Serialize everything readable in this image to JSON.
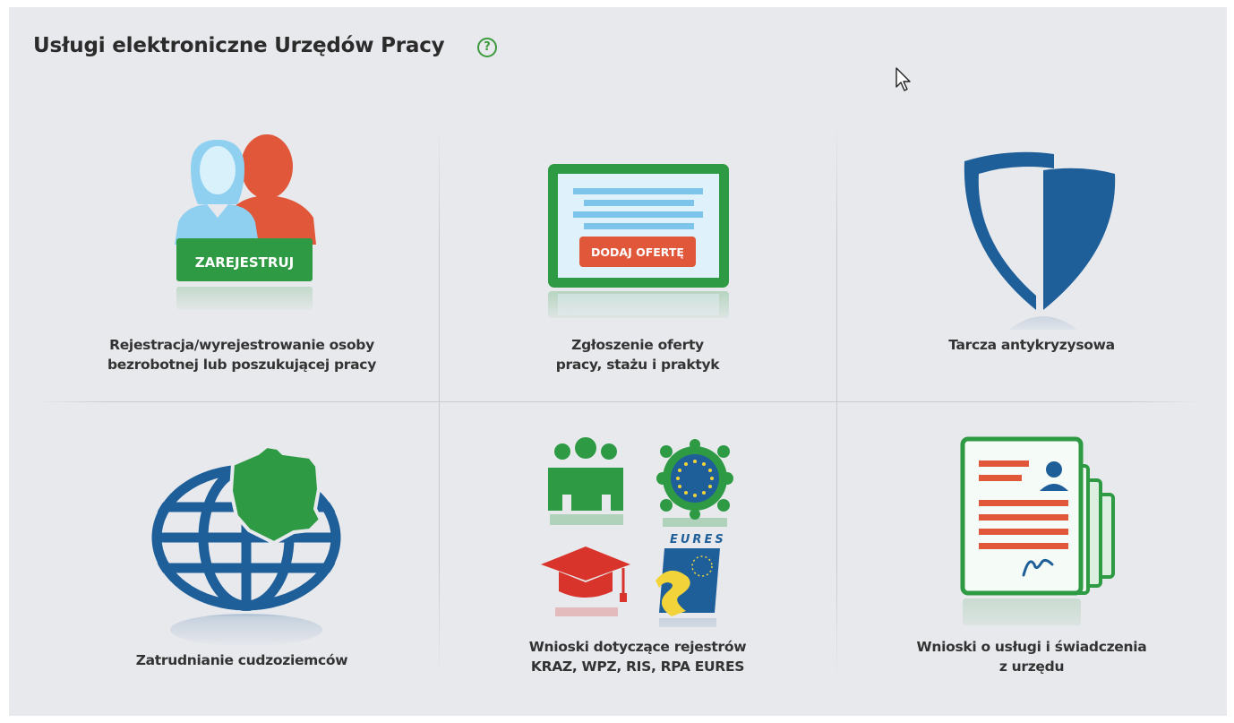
{
  "page": {
    "title": "Usługi elektroniczne Urzędów Pracy",
    "help_symbol": "?"
  },
  "tiles": [
    {
      "id": "registration",
      "icon": "people-register-icon",
      "badge": "ZAREJESTRUJ",
      "label_line1": "Rejestracja/wyrejestrowanie osoby",
      "label_line2": "bezrobotnej lub poszukującej pracy"
    },
    {
      "id": "job-offer",
      "icon": "job-offer-screen-icon",
      "badge": "DODAJ OFERTĘ",
      "label_line1": "Zgłoszenie oferty",
      "label_line2": "pracy, stażu i praktyk"
    },
    {
      "id": "anti-crisis-shield",
      "icon": "shield-icon",
      "label_line1": "Tarcza antykryzysowa",
      "label_line2": ""
    },
    {
      "id": "foreigners",
      "icon": "globe-poland-icon",
      "label_line1": "Zatrudnianie cudzoziemców",
      "label_line2": ""
    },
    {
      "id": "registers",
      "icon": "registers-icon",
      "eures_text": "EURES",
      "label_line1": "Wnioski dotyczące rejestrów",
      "label_line2": "KRAZ, WPZ, RIS, RPA EURES"
    },
    {
      "id": "services",
      "icon": "documents-icon",
      "label_line1": "Wnioski o usługi i świadczenia",
      "label_line2": "z urzędu"
    }
  ],
  "colors": {
    "panel_bg": "#e8e9ed",
    "green": "#3d9b3d",
    "dark_green": "#2e8a3a",
    "orange_red": "#e0573a",
    "light_blue": "#8fd0f0",
    "navy": "#1f5f99",
    "text": "#333333"
  }
}
